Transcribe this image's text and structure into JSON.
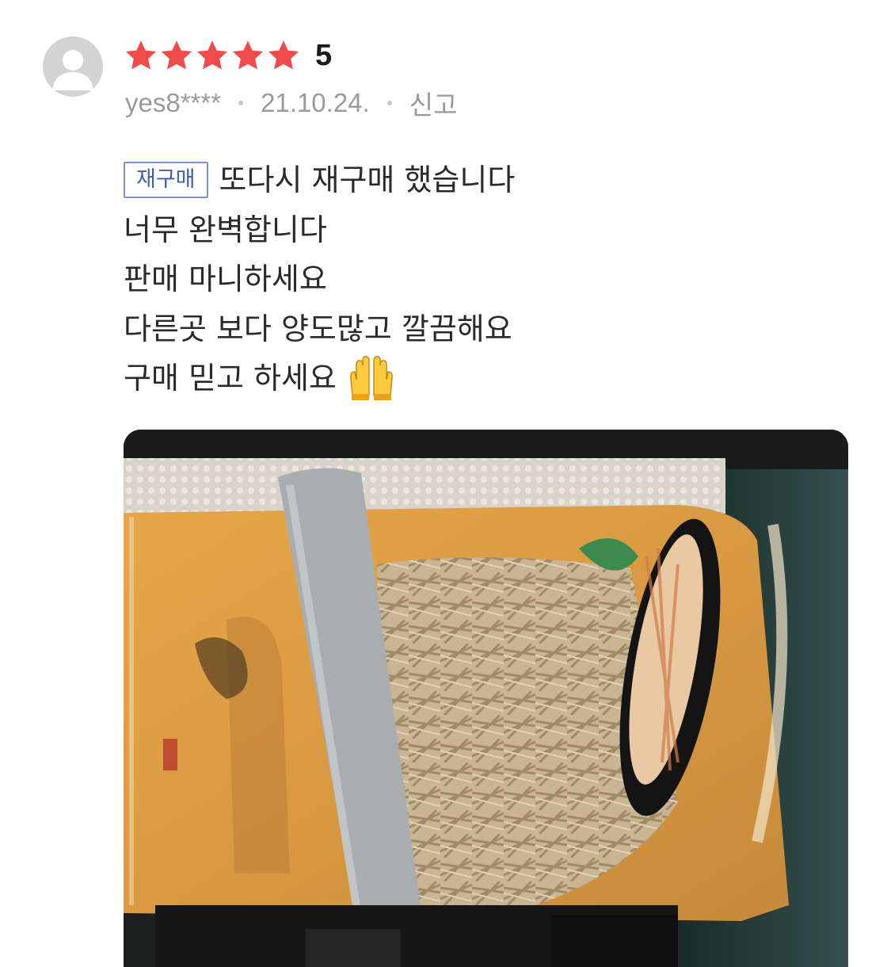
{
  "review": {
    "avatar_icon": "default-user-icon",
    "rating_value": "5",
    "star_count": 5,
    "star_color": "#f04b4b",
    "username": "yes8****",
    "date": "21.10.24.",
    "report_label": "신고",
    "repurchase_tag": "재구매",
    "lines": [
      "또다시 재구매 했습니다",
      "너무 완벽합니다",
      "판매 마니하세요",
      "다른곳 보다 양도많고 깔끔해요",
      "구매 믿고 하세요"
    ],
    "emoji_icon": "raising-hands-emoji",
    "tag_color": "#3e5fa8"
  }
}
